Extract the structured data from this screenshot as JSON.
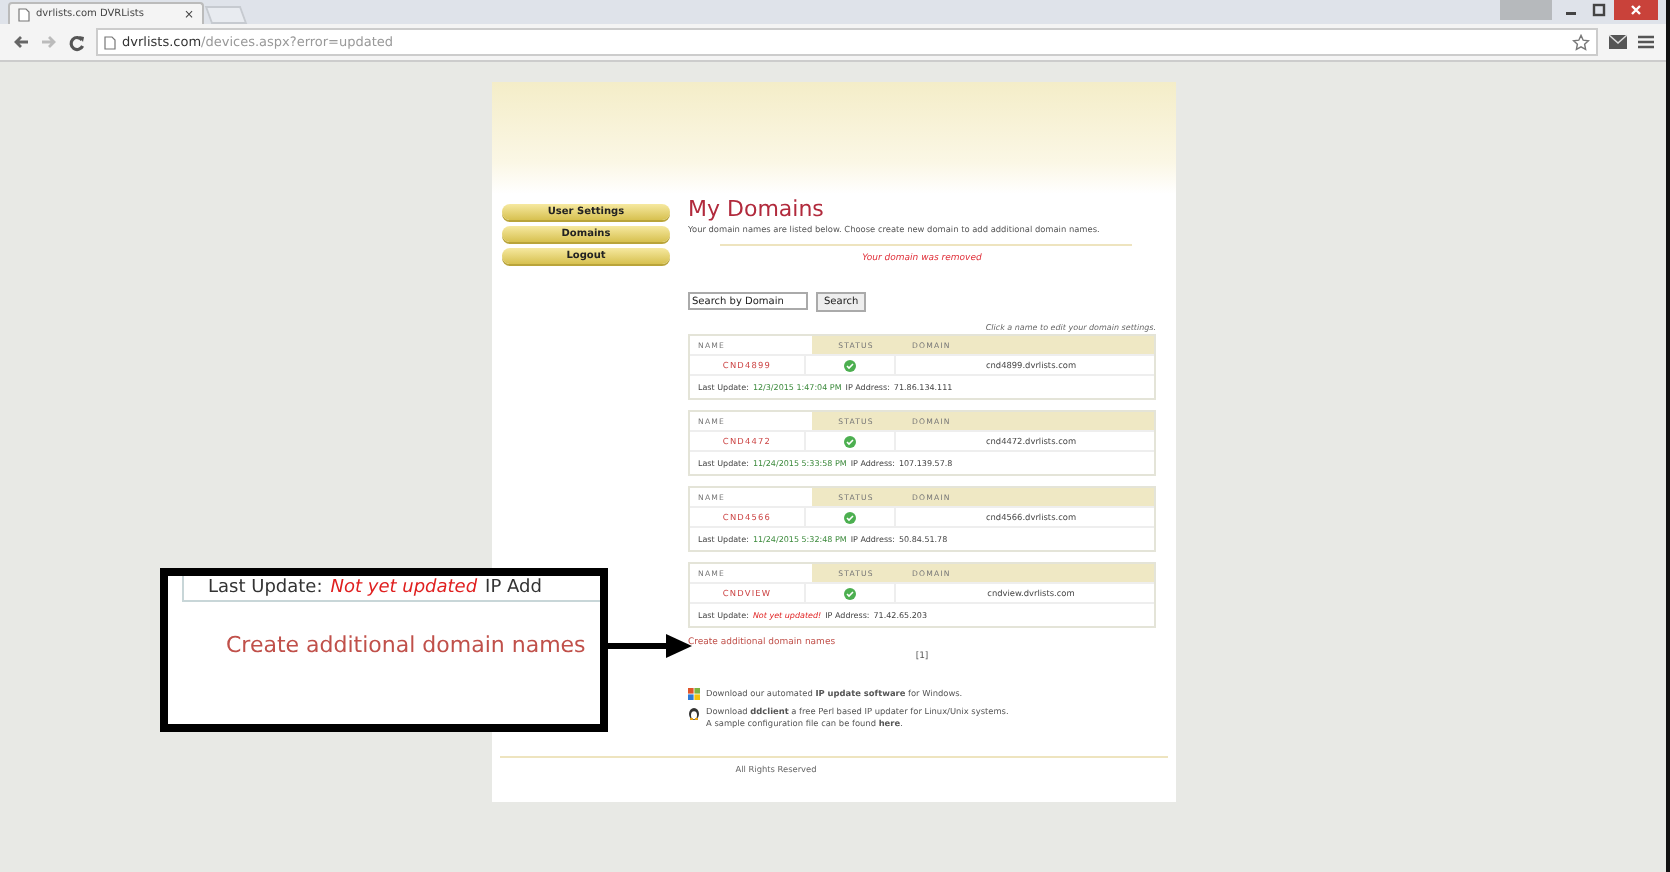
{
  "browser": {
    "tab_title": "dvrlists.com DVRLists",
    "tab_close": "×",
    "url_domain": "dvrlists.com",
    "url_path": "/devices.aspx?error=updated"
  },
  "sidebar": {
    "items": [
      {
        "label": "User Settings"
      },
      {
        "label": "Domains"
      },
      {
        "label": "Logout"
      }
    ]
  },
  "main": {
    "title": "My Domains",
    "intro": "Your domain names are listed below. Choose create new domain to add additional domain names.",
    "message": "Your domain was removed",
    "search_value": "Search by Domain",
    "search_button": "Search",
    "hint": "Click a name to edit your domain settings.",
    "domains": [
      {
        "columns": [
          "NAME",
          "STATUS",
          "DOMAIN"
        ],
        "name": "CND4899",
        "domain": "cnd4899.dvrlists.com",
        "last_update_label": "Last Update:",
        "last_update": "12/3/2015 1:47:04 PM",
        "updated": true,
        "ip_label": "IP Address:",
        "ip": "71.86.134.111"
      },
      {
        "columns": [
          "NAME",
          "STATUS",
          "DOMAIN"
        ],
        "name": "CND4472",
        "domain": "cnd4472.dvrlists.com",
        "last_update_label": "Last Update:",
        "last_update": "11/24/2015 5:33:58 PM",
        "updated": true,
        "ip_label": "IP Address:",
        "ip": "107.139.57.8"
      },
      {
        "columns": [
          "NAME",
          "STATUS",
          "DOMAIN"
        ],
        "name": "CND4566",
        "domain": "cnd4566.dvrlists.com",
        "last_update_label": "Last Update:",
        "last_update": "11/24/2015 5:32:48 PM",
        "updated": true,
        "ip_label": "IP Address:",
        "ip": "50.84.51.78"
      },
      {
        "columns": [
          "NAME",
          "STATUS",
          "DOMAIN"
        ],
        "name": "CNDVIEW",
        "domain": "cndview.dvrlists.com",
        "last_update_label": "Last Update:",
        "last_update": "Not yet updated!",
        "updated": false,
        "ip_label": "IP Address:",
        "ip": "71.42.65.203"
      }
    ],
    "create_link": "Create additional domain names",
    "pager": "[1]",
    "downloads": [
      {
        "kind": "windows",
        "lines": [
          "Download our automated **IP update software** for Windows."
        ]
      },
      {
        "kind": "linux",
        "lines": [
          "Download **ddclient** a free Perl based IP updater for Linux/Unix systems.",
          "A sample configuration file can be found **here**."
        ]
      }
    ],
    "footer": "All Rights Reserved"
  },
  "callout": {
    "last_update_label": "Last Update:",
    "last_update": "Not yet updated",
    "ip_label": "IP Add",
    "link": "Create additional domain names"
  }
}
